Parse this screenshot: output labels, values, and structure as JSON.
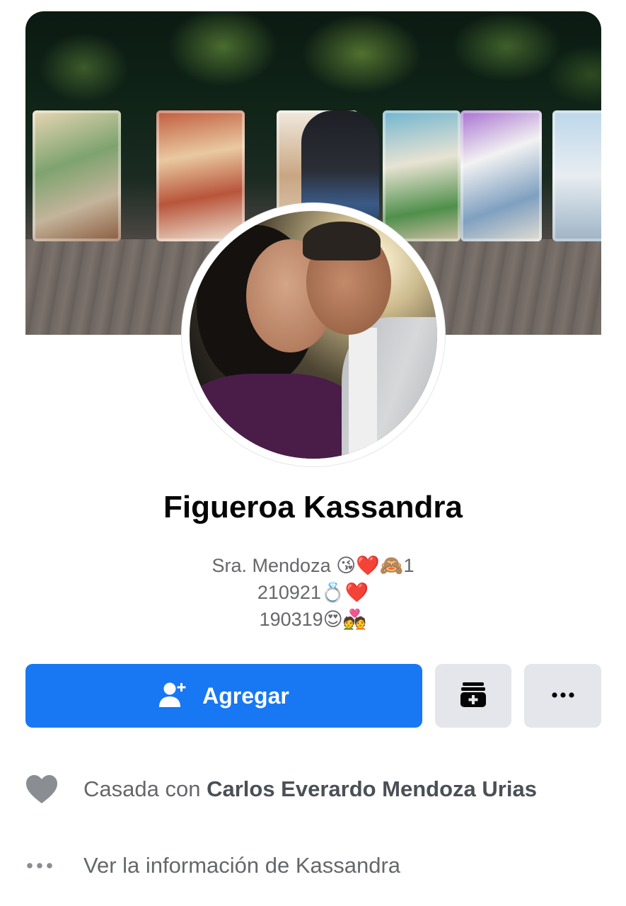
{
  "profile": {
    "name": "Figueroa Kassandra",
    "bio_lines": [
      "Sra. Mendoza 😘❤️🙈1",
      "210921💍❤️",
      "190319😍💑"
    ]
  },
  "actions": {
    "add_label": "Agregar",
    "add_icon": "add-friend-icon",
    "collection_icon": "archive-plus-icon",
    "more_icon": "more-dots-icon"
  },
  "info": {
    "relationship_prefix": "Casada con",
    "relationship_partner": "Carlos Everardo Mendoza Urias",
    "relationship_icon": "heart-icon",
    "see_info_label": "Ver la información de Kassandra",
    "see_info_icon": "more-dots-icon"
  },
  "colors": {
    "primary": "#1877f2",
    "button_gray": "#e4e6eb",
    "secondary_text": "#65676b",
    "name_text": "#050505"
  }
}
